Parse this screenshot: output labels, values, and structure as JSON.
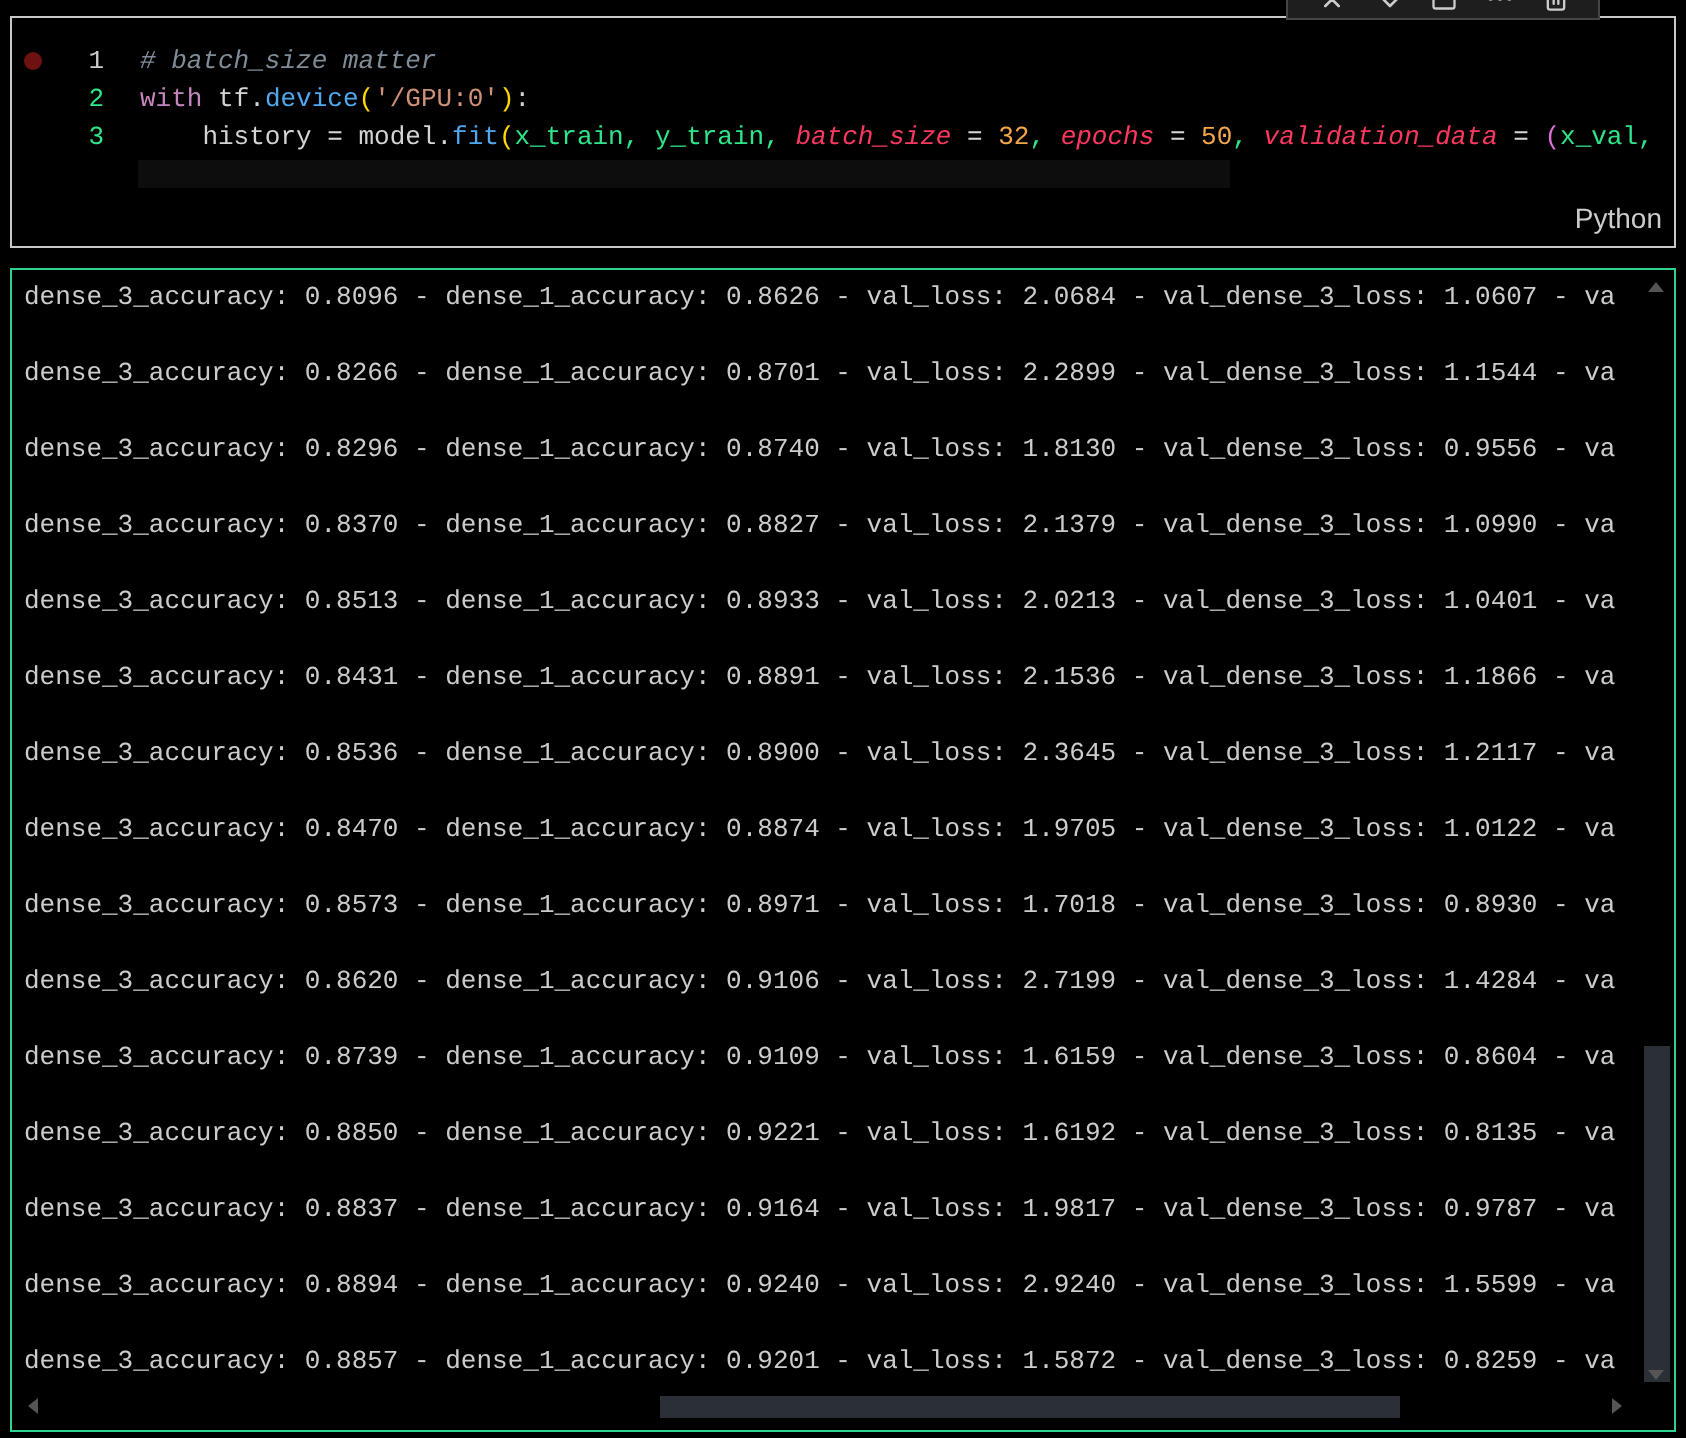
{
  "code_cell": {
    "breakpoint": true,
    "lines": [
      {
        "number": "1",
        "tokens": [
          {
            "kind": "comment",
            "text": "# batch_size matter"
          }
        ]
      },
      {
        "number": "2",
        "tokens": [
          {
            "kind": "keyword",
            "text": "with"
          },
          {
            "kind": "plain",
            "text": " tf."
          },
          {
            "kind": "func",
            "text": "device"
          },
          {
            "kind": "paren",
            "text": "("
          },
          {
            "kind": "string",
            "text": "'/GPU:0'"
          },
          {
            "kind": "paren",
            "text": ")"
          },
          {
            "kind": "plain",
            "text": ":"
          }
        ]
      },
      {
        "number": "3",
        "tokens": [
          {
            "kind": "plain",
            "text": "    history = model."
          },
          {
            "kind": "func",
            "text": "fit"
          },
          {
            "kind": "paren",
            "text": "("
          },
          {
            "kind": "var",
            "text": "x_train, y_train, "
          },
          {
            "kind": "param",
            "text": "batch_size"
          },
          {
            "kind": "plain",
            "text": " = "
          },
          {
            "kind": "number",
            "text": "32"
          },
          {
            "kind": "var",
            "text": ", "
          },
          {
            "kind": "param",
            "text": "epochs"
          },
          {
            "kind": "plain",
            "text": " = "
          },
          {
            "kind": "number",
            "text": "50"
          },
          {
            "kind": "var",
            "text": ", "
          },
          {
            "kind": "param",
            "text": "validation_data"
          },
          {
            "kind": "plain",
            "text": " = "
          },
          {
            "kind": "paren2",
            "text": "("
          },
          {
            "kind": "var",
            "text": "x_val,"
          }
        ]
      }
    ],
    "language": "Python"
  },
  "output_lines": [
    "dense_3_accuracy: 0.8096 - dense_1_accuracy: 0.8626 - val_loss: 2.0684 - val_dense_3_loss: 1.0607 - va",
    "dense_3_accuracy: 0.8266 - dense_1_accuracy: 0.8701 - val_loss: 2.2899 - val_dense_3_loss: 1.1544 - va",
    "dense_3_accuracy: 0.8296 - dense_1_accuracy: 0.8740 - val_loss: 1.8130 - val_dense_3_loss: 0.9556 - va",
    "dense_3_accuracy: 0.8370 - dense_1_accuracy: 0.8827 - val_loss: 2.1379 - val_dense_3_loss: 1.0990 - va",
    "dense_3_accuracy: 0.8513 - dense_1_accuracy: 0.8933 - val_loss: 2.0213 - val_dense_3_loss: 1.0401 - va",
    "dense_3_accuracy: 0.8431 - dense_1_accuracy: 0.8891 - val_loss: 2.1536 - val_dense_3_loss: 1.1866 - va",
    "dense_3_accuracy: 0.8536 - dense_1_accuracy: 0.8900 - val_loss: 2.3645 - val_dense_3_loss: 1.2117 - va",
    "dense_3_accuracy: 0.8470 - dense_1_accuracy: 0.8874 - val_loss: 1.9705 - val_dense_3_loss: 1.0122 - va",
    "dense_3_accuracy: 0.8573 - dense_1_accuracy: 0.8971 - val_loss: 1.7018 - val_dense_3_loss: 0.8930 - va",
    "dense_3_accuracy: 0.8620 - dense_1_accuracy: 0.9106 - val_loss: 2.7199 - val_dense_3_loss: 1.4284 - va",
    "dense_3_accuracy: 0.8739 - dense_1_accuracy: 0.9109 - val_loss: 1.6159 - val_dense_3_loss: 0.8604 - va",
    "dense_3_accuracy: 0.8850 - dense_1_accuracy: 0.9221 - val_loss: 1.6192 - val_dense_3_loss: 0.8135 - va",
    "dense_3_accuracy: 0.8837 - dense_1_accuracy: 0.9164 - val_loss: 1.9817 - val_dense_3_loss: 0.9787 - va",
    "dense_3_accuracy: 0.8894 - dense_1_accuracy: 0.9240 - val_loss: 2.9240 - val_dense_3_loss: 1.5599 - va",
    "dense_3_accuracy: 0.8857 - dense_1_accuracy: 0.9201 - val_loss: 1.5872 - val_dense_3_loss: 0.8259 - va"
  ]
}
